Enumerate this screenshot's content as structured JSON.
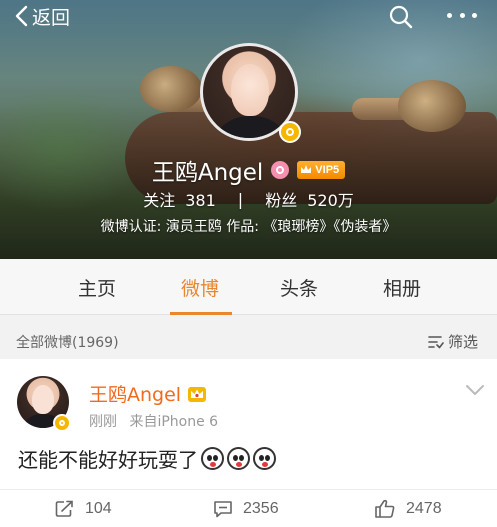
{
  "nav": {
    "back_label": "返回",
    "icons": [
      "chevron-left-icon",
      "search-icon",
      "more-icon"
    ]
  },
  "profile": {
    "name": "王鸥Angel",
    "vip_badge": "VIP5",
    "follow_label": "关注",
    "follow_count": "381",
    "separator": "|",
    "fans_label": "粉丝",
    "fans_count": "520万",
    "verification": "微博认证: 演员王鸥 作品: 《琅琊榜》《伪装者》"
  },
  "tabs": [
    {
      "label": "主页",
      "active": false
    },
    {
      "label": "微博",
      "active": true
    },
    {
      "label": "头条",
      "active": false
    },
    {
      "label": "相册",
      "active": false
    }
  ],
  "filter": {
    "title": "全部微博(1969)",
    "button": "筛选"
  },
  "post": {
    "author": "王鸥Angel",
    "time": "刚刚",
    "source": "来自iPhone 6",
    "text": "还能不能好好玩耍了",
    "emoji_count": 3,
    "reposts": "104",
    "comments": "2356",
    "likes": "2478"
  },
  "colors": {
    "accent": "#e9872c",
    "author": "#f26b1d",
    "vip_gold": "#f5b700"
  }
}
